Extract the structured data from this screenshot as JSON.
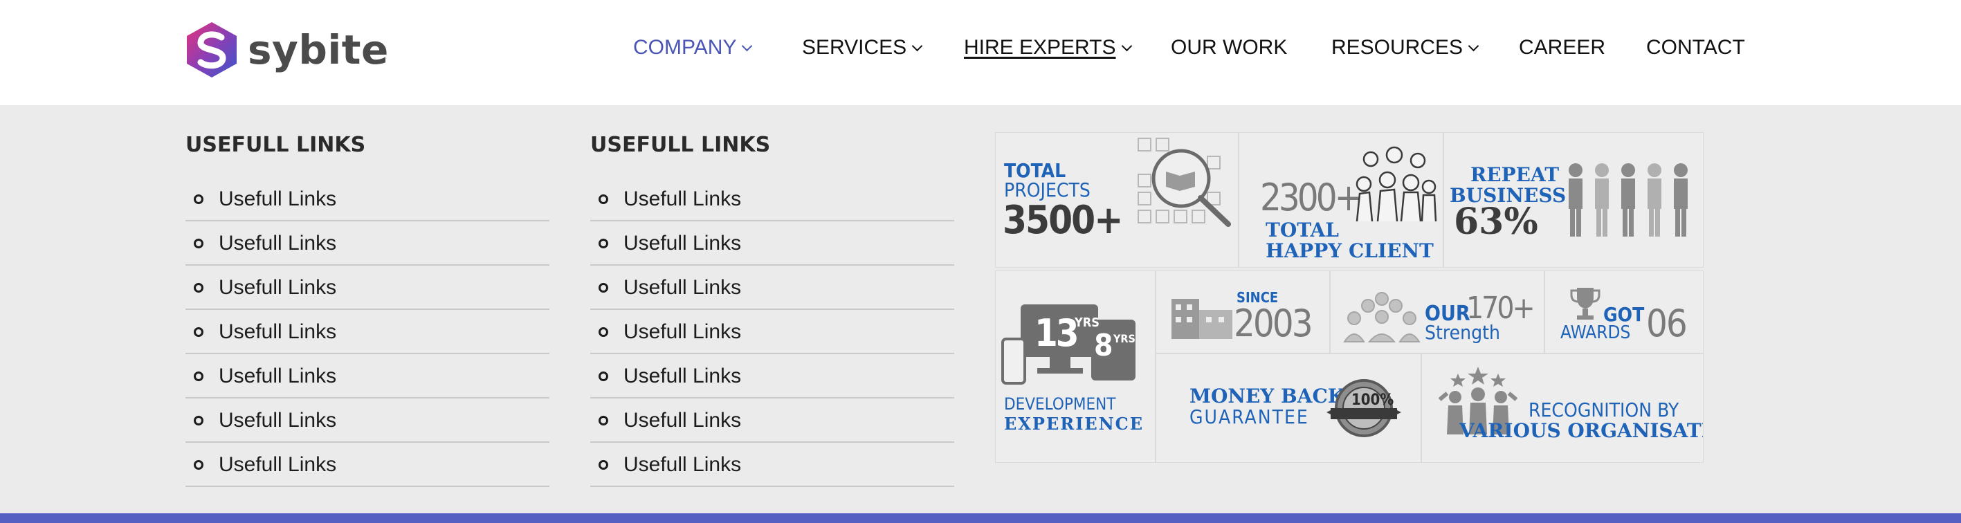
{
  "brand": {
    "name": "sybite"
  },
  "nav": {
    "items": [
      {
        "label": "COMPANY",
        "dropdown": true,
        "active": true
      },
      {
        "label": "SERVICES",
        "dropdown": true
      },
      {
        "label": "HIRE EXPERTS",
        "dropdown": true,
        "underline": true
      },
      {
        "label": "OUR WORK",
        "dropdown": false
      },
      {
        "label": "RESOURCES",
        "dropdown": true
      },
      {
        "label": "CAREER",
        "dropdown": false
      },
      {
        "label": "CONTACT",
        "dropdown": false
      }
    ],
    "active_color": "#4a55b5"
  },
  "mega_menu": {
    "columns": [
      {
        "title": "USEFULL LINKS",
        "links": [
          "Usefull Links",
          "Usefull Links",
          "Usefull Links",
          "Usefull Links",
          "Usefull Links",
          "Usefull Links",
          "Usefull Links"
        ]
      },
      {
        "title": "USEFULL LINKS",
        "links": [
          "Usefull Links",
          "Usefull Links",
          "Usefull Links",
          "Usefull Links",
          "Usefull Links",
          "Usefull Links",
          "Usefull Links"
        ]
      }
    ]
  },
  "stats": {
    "projects": {
      "line1": "TOTAL",
      "line2": "PROJECTS",
      "value": "3500+"
    },
    "clients": {
      "value": "2300+",
      "line1": "TOTAL",
      "line2": "HAPPY CLIENT"
    },
    "repeat": {
      "line1": "REPEAT",
      "line2": "BUSINESS",
      "value": "63%"
    },
    "experience": {
      "years_big": "13",
      "years_small": "8",
      "yrs": "YRS",
      "line1": "DEVELOPMENT",
      "line2": "EXPERIENCE"
    },
    "since": {
      "label": "SINCE",
      "year": "2003"
    },
    "strength": {
      "our": "OUR",
      "value": "170+",
      "label": "Strength"
    },
    "awards": {
      "got": "GOT",
      "label": "AWARDS",
      "value": "06"
    },
    "guarantee": {
      "line1": "MONEY BACK",
      "line2": "GUARANTEE",
      "seal": "100%"
    },
    "recognition": {
      "line1": "RECOGNITION BY",
      "line2": "VARIOUS ORGANISATION"
    }
  },
  "colors": {
    "accent": "#5560c2",
    "stat_blue": "#1f63b8",
    "menu_bg": "#ebebeb"
  }
}
